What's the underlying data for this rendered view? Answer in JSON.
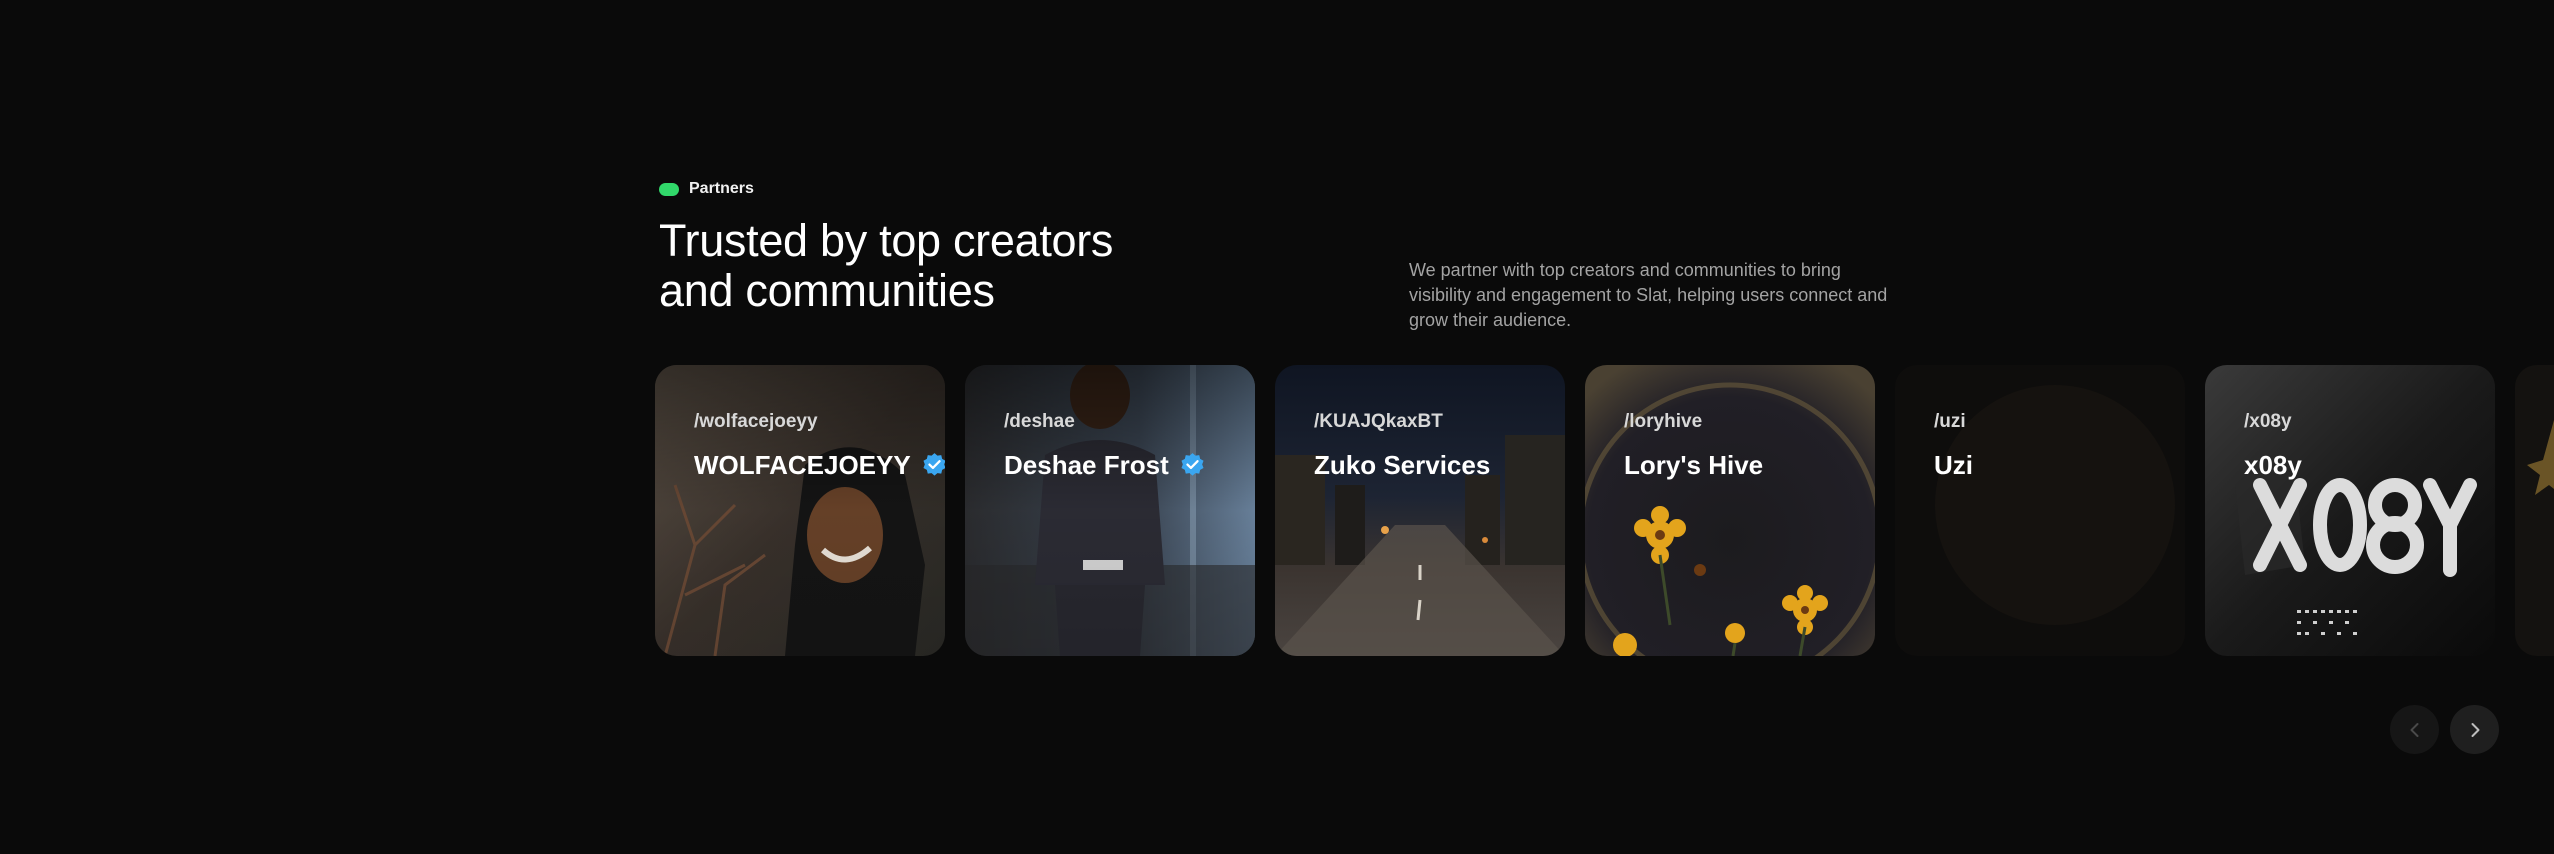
{
  "section": {
    "badge": "Partners",
    "heading_line1": "Trusted by top creators",
    "heading_line2": "and communities",
    "description": "We partner with top creators and communities to bring visibility and engagement to Slat, helping users connect and grow their audience."
  },
  "partners": [
    {
      "handle": "/wolfacejoeyy",
      "name": "WOLFACEJOEYY",
      "verified": true
    },
    {
      "handle": "/deshae",
      "name": "Deshae Frost",
      "verified": true
    },
    {
      "handle": "/KUAJQkaxBT",
      "name": "Zuko Services",
      "verified": false
    },
    {
      "handle": "/loryhive",
      "name": "Lory's Hive",
      "verified": false
    },
    {
      "handle": "/uzi",
      "name": "Uzi",
      "verified": false
    },
    {
      "handle": "/x08y",
      "name": "x08y",
      "verified": false
    }
  ],
  "colors": {
    "background": "#0a0a0a",
    "badge_dot": "#31d86a",
    "verified": "#3aa6f0",
    "description_text": "#a3a3a3"
  },
  "icons": {
    "verified": "verified-badge-icon",
    "prev": "chevron-left-icon",
    "next": "chevron-right-icon"
  }
}
